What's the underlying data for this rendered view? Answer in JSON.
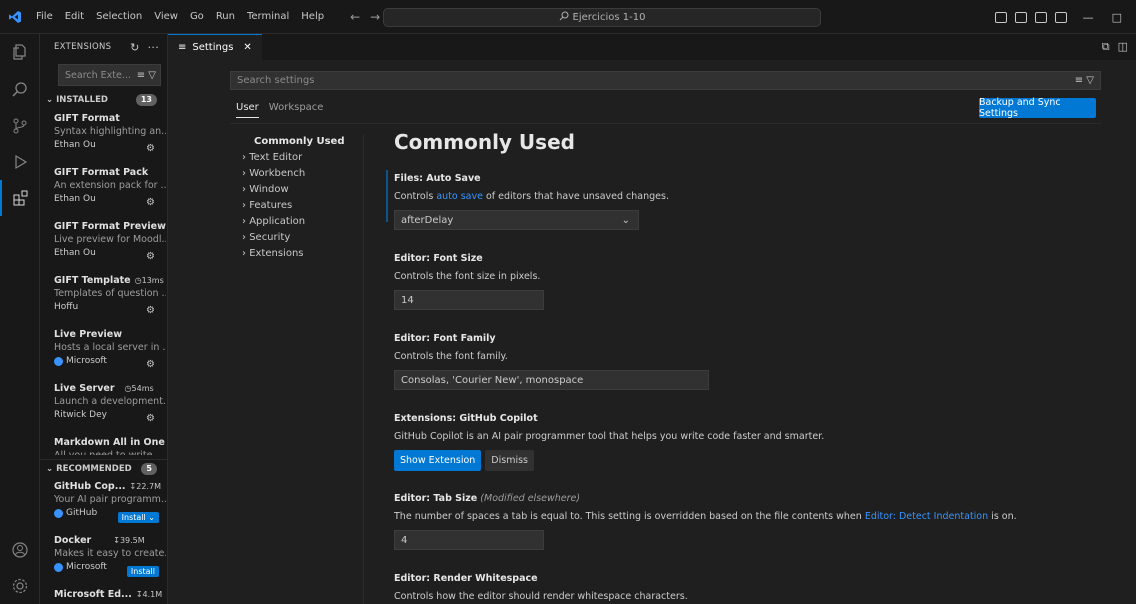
{
  "titlebar": {
    "menu": [
      "File",
      "Edit",
      "Selection",
      "View",
      "Go",
      "Run",
      "Terminal",
      "Help"
    ],
    "command_center": "Ejercicios 1-10"
  },
  "sidebar": {
    "title": "EXTENSIONS",
    "search_placeholder": "Search Exte...",
    "installed": {
      "label": "INSTALLED",
      "count": "13",
      "items": [
        {
          "name": "GIFT Format",
          "desc": "Syntax highlighting an...",
          "publisher": "Ethan Ou"
        },
        {
          "name": "GIFT Format Pack",
          "desc": "An extension pack for ...",
          "publisher": "Ethan Ou"
        },
        {
          "name": "GIFT Format Preview",
          "desc": "Live preview for Moodl...",
          "publisher": "Ethan Ou"
        },
        {
          "name": "GIFT Template",
          "meta": "13ms",
          "desc": "Templates of question ...",
          "publisher": "Hoffu"
        },
        {
          "name": "Live Preview",
          "desc": "Hosts a local server in ...",
          "publisher": "Microsoft"
        },
        {
          "name": "Live Server",
          "meta": "54ms",
          "desc": "Launch a development...",
          "publisher": "Ritwick Dey"
        },
        {
          "name": "Markdown All in One",
          "desc": "All you need to write ...",
          "publisher": ""
        }
      ]
    },
    "recommended": {
      "label": "RECOMMENDED",
      "count": "5",
      "items": [
        {
          "name": "GitHub Cop...",
          "meta": "22.7M",
          "desc": "Your AI pair programm...",
          "publisher": "GitHub",
          "action": "Install"
        },
        {
          "name": "Docker",
          "meta": "39.5M",
          "desc": "Makes it easy to create...",
          "publisher": "Microsoft",
          "action": "Install"
        },
        {
          "name": "Microsoft Ed...",
          "meta": "4.1M",
          "desc": "",
          "publisher": "",
          "action": ""
        }
      ]
    }
  },
  "tab": {
    "label": "Settings"
  },
  "settings": {
    "search_placeholder": "Search settings",
    "scopes": [
      "User",
      "Workspace"
    ],
    "sync_button": "Backup and Sync Settings",
    "toc": [
      "Commonly Used",
      "Text Editor",
      "Workbench",
      "Window",
      "Features",
      "Application",
      "Security",
      "Extensions"
    ],
    "page_title": "Commonly Used",
    "items": {
      "auto_save": {
        "category": "Files: ",
        "title": "Auto Save",
        "desc_pre": "Controls ",
        "desc_link": "auto save",
        "desc_post": " of editors that have unsaved changes.",
        "value": "afterDelay"
      },
      "font_size": {
        "category": "Editor: ",
        "title": "Font Size",
        "desc": "Controls the font size in pixels.",
        "value": "14"
      },
      "font_family": {
        "category": "Editor: ",
        "title": "Font Family",
        "desc": "Controls the font family.",
        "value": "Consolas, 'Courier New', monospace"
      },
      "copilot": {
        "category": "Extensions: ",
        "title": "GitHub Copilot",
        "desc": "GitHub Copilot is an AI pair programmer tool that helps you write code faster and smarter.",
        "primary": "Show Extension",
        "secondary": "Dismiss"
      },
      "tab_size": {
        "category": "Editor: ",
        "title": "Tab Size",
        "note": "(Modified elsewhere)",
        "desc_pre": "The number of spaces a tab is equal to. This setting is overridden based on the file contents when ",
        "desc_link": "Editor: Detect Indentation",
        "desc_post": " is on.",
        "value": "4"
      },
      "render_ws": {
        "category": "Editor: ",
        "title": "Render Whitespace",
        "desc": "Controls how the editor should render whitespace characters."
      }
    }
  },
  "colors": {
    "accent": "#0078d4",
    "link": "#3794ff",
    "background": "#1f1f1f",
    "sidebar": "#181818"
  }
}
